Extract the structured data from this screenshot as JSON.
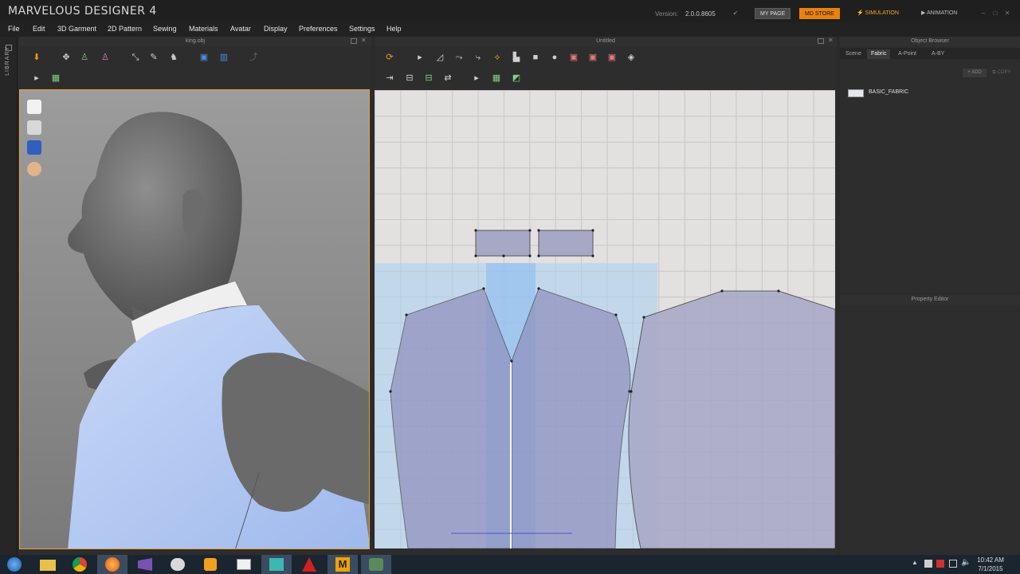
{
  "app": {
    "title": "MARVELOUS DESIGNER 4",
    "version_label": "Version:",
    "version": "2.0.0.8605",
    "my_page": "MY PAGE",
    "md_store": "MD STORE",
    "mode_simulation": "SIMULATION",
    "mode_animation": "ANIMATION"
  },
  "menu": [
    "File",
    "Edit",
    "3D Garment",
    "2D Pattern",
    "Sewing",
    "Materials",
    "Avatar",
    "Display",
    "Preferences",
    "Settings",
    "Help"
  ],
  "library_label": "LIBRARY",
  "panel3d": {
    "title": "king.obj"
  },
  "panel2d": {
    "title": "Untitled"
  },
  "object_browser": {
    "title": "Object Browser",
    "tabs": [
      "Scene",
      "Fabric",
      "A-Point",
      "A-BY"
    ],
    "active_tab": "Fabric",
    "add_label": "ADD",
    "copy_label": "COPY",
    "fabrics": [
      {
        "name": "BASIC_FABRIC",
        "color": "#e6e6ef"
      }
    ]
  },
  "property_editor": {
    "title": "Property Editor"
  },
  "taskbar": {
    "time": "10:42 AM",
    "date": "7/1/2015",
    "apps": [
      "windows-start",
      "file-explorer",
      "chrome",
      "firefox",
      "visual-studio",
      "paint",
      "media-player",
      "window-app",
      "maya",
      "autocad",
      "marvelous-designer",
      "generic-app"
    ]
  },
  "colors": {
    "accent": "#e8820c",
    "panel_bg": "#2d2d2d",
    "pattern_fill": "#a7a7c6",
    "selection_blue": "#a9cff4"
  }
}
